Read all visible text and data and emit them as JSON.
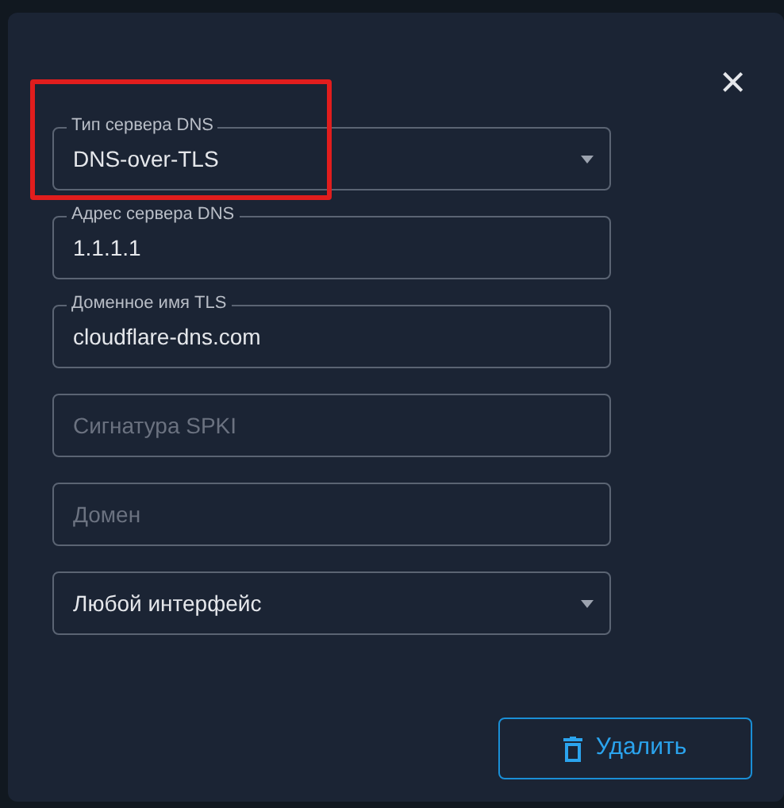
{
  "dialog": {
    "close": "×"
  },
  "fields": [
    {
      "kind": "select",
      "label": "Тип сервера DNS",
      "value": "DNS-over-TLS",
      "highlighted": true
    },
    {
      "kind": "input",
      "label": "Адрес сервера DNS",
      "value": "1.1.1.1",
      "highlighted": false
    },
    {
      "kind": "input",
      "label": "Доменное имя TLS",
      "value": "cloudflare-dns.com",
      "highlighted": false
    },
    {
      "kind": "input",
      "placeholder": "Сигнатура SPKI",
      "highlighted": false
    },
    {
      "kind": "input",
      "placeholder": "Домен",
      "highlighted": false
    },
    {
      "kind": "select",
      "value": "Любой интерфейс",
      "highlighted": false
    }
  ],
  "delete_button": {
    "label": "Удалить"
  }
}
